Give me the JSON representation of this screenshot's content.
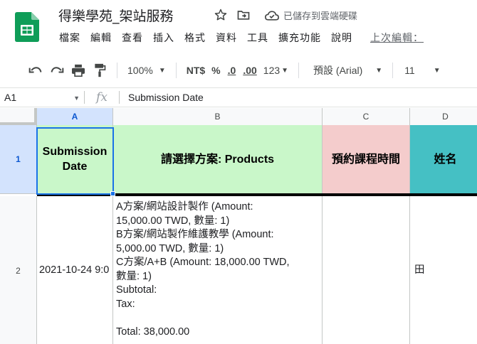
{
  "app": {
    "doc_title": "得樂學苑_架站服務",
    "save_status": "已儲存到雲端硬碟",
    "icons": {
      "logo": "google-sheets-logo",
      "star": "star-icon",
      "move": "move-to-folder-icon",
      "cloud": "cloud-saved-icon"
    }
  },
  "menu": {
    "items": [
      "檔案",
      "編輯",
      "查看",
      "插入",
      "格式",
      "資料",
      "工具",
      "擴充功能",
      "說明"
    ],
    "last_edit": "上次編輯："
  },
  "toolbar": {
    "zoom": "100%",
    "currency": "NT$",
    "percent": "%",
    "decrease_decimal": ".0",
    "increase_decimal": ".00",
    "more_formats": "123",
    "font": "預設 (Arial)",
    "font_size": "11"
  },
  "formula_bar": {
    "cell_ref": "A1",
    "fx": "fx",
    "value": "Submission Date"
  },
  "grid": {
    "columns": [
      "A",
      "B",
      "C",
      "D"
    ],
    "rows": [
      "1",
      "2"
    ],
    "header_cells": [
      "Submission Date",
      "請選擇方案: Products",
      "預約課程時間",
      "姓名"
    ],
    "header_colors": [
      "#c9f7c9",
      "#c9f7c9",
      "#f4cccc",
      "#45c0c4"
    ],
    "row2": {
      "date": "2021-10-24 9:0",
      "products": [
        "A方案/網站設計製作 (Amount:",
        "15,000.00 TWD, 數量: 1)",
        "B方案/網站製作維護教學 (Amount:",
        "5,000.00 TWD, 數量: 1)",
        "C方案/A+B (Amount: 18,000.00 TWD,",
        "數量: 1)",
        "Subtotal:",
        "Tax:",
        "",
        "Total: 38,000.00"
      ],
      "course_time": "",
      "name": "田"
    }
  }
}
